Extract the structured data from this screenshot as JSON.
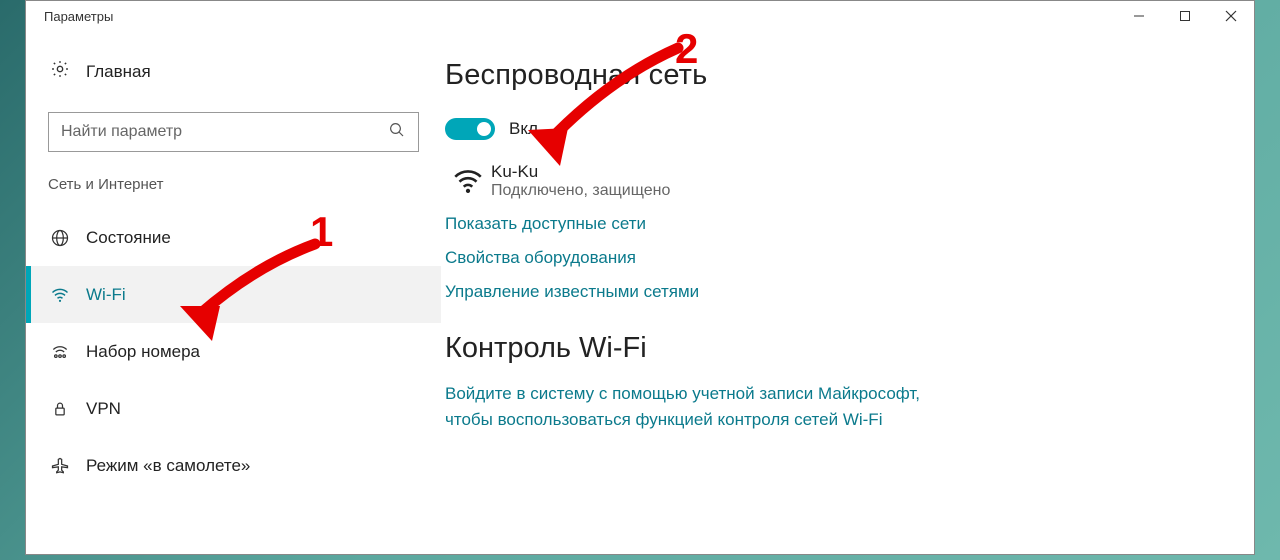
{
  "window": {
    "title": "Параметры"
  },
  "sidebar": {
    "home": "Главная",
    "search_placeholder": "Найти параметр",
    "group": "Сеть и Интернет",
    "items": [
      {
        "label": "Состояние"
      },
      {
        "label": "Wi-Fi",
        "selected": true
      },
      {
        "label": "Набор номера"
      },
      {
        "label": "VPN"
      },
      {
        "label": "Режим «в самолете»"
      }
    ]
  },
  "main": {
    "heading": "Беспроводная сеть",
    "toggle_label": "Вкл.",
    "network": {
      "name": "Ku-Ku",
      "status": "Подключено, защищено"
    },
    "links": {
      "show_networks": "Показать доступные сети",
      "hw_props": "Свойства оборудования",
      "manage_known": "Управление известными сетями"
    },
    "section2_heading": "Контроль Wi-Fi",
    "section2_desc": "Войдите в систему с помощью учетной записи Майкрософт, чтобы воспользоваться функцией контроля сетей Wi-Fi"
  },
  "annotations": {
    "n1": "1",
    "n2": "2"
  }
}
